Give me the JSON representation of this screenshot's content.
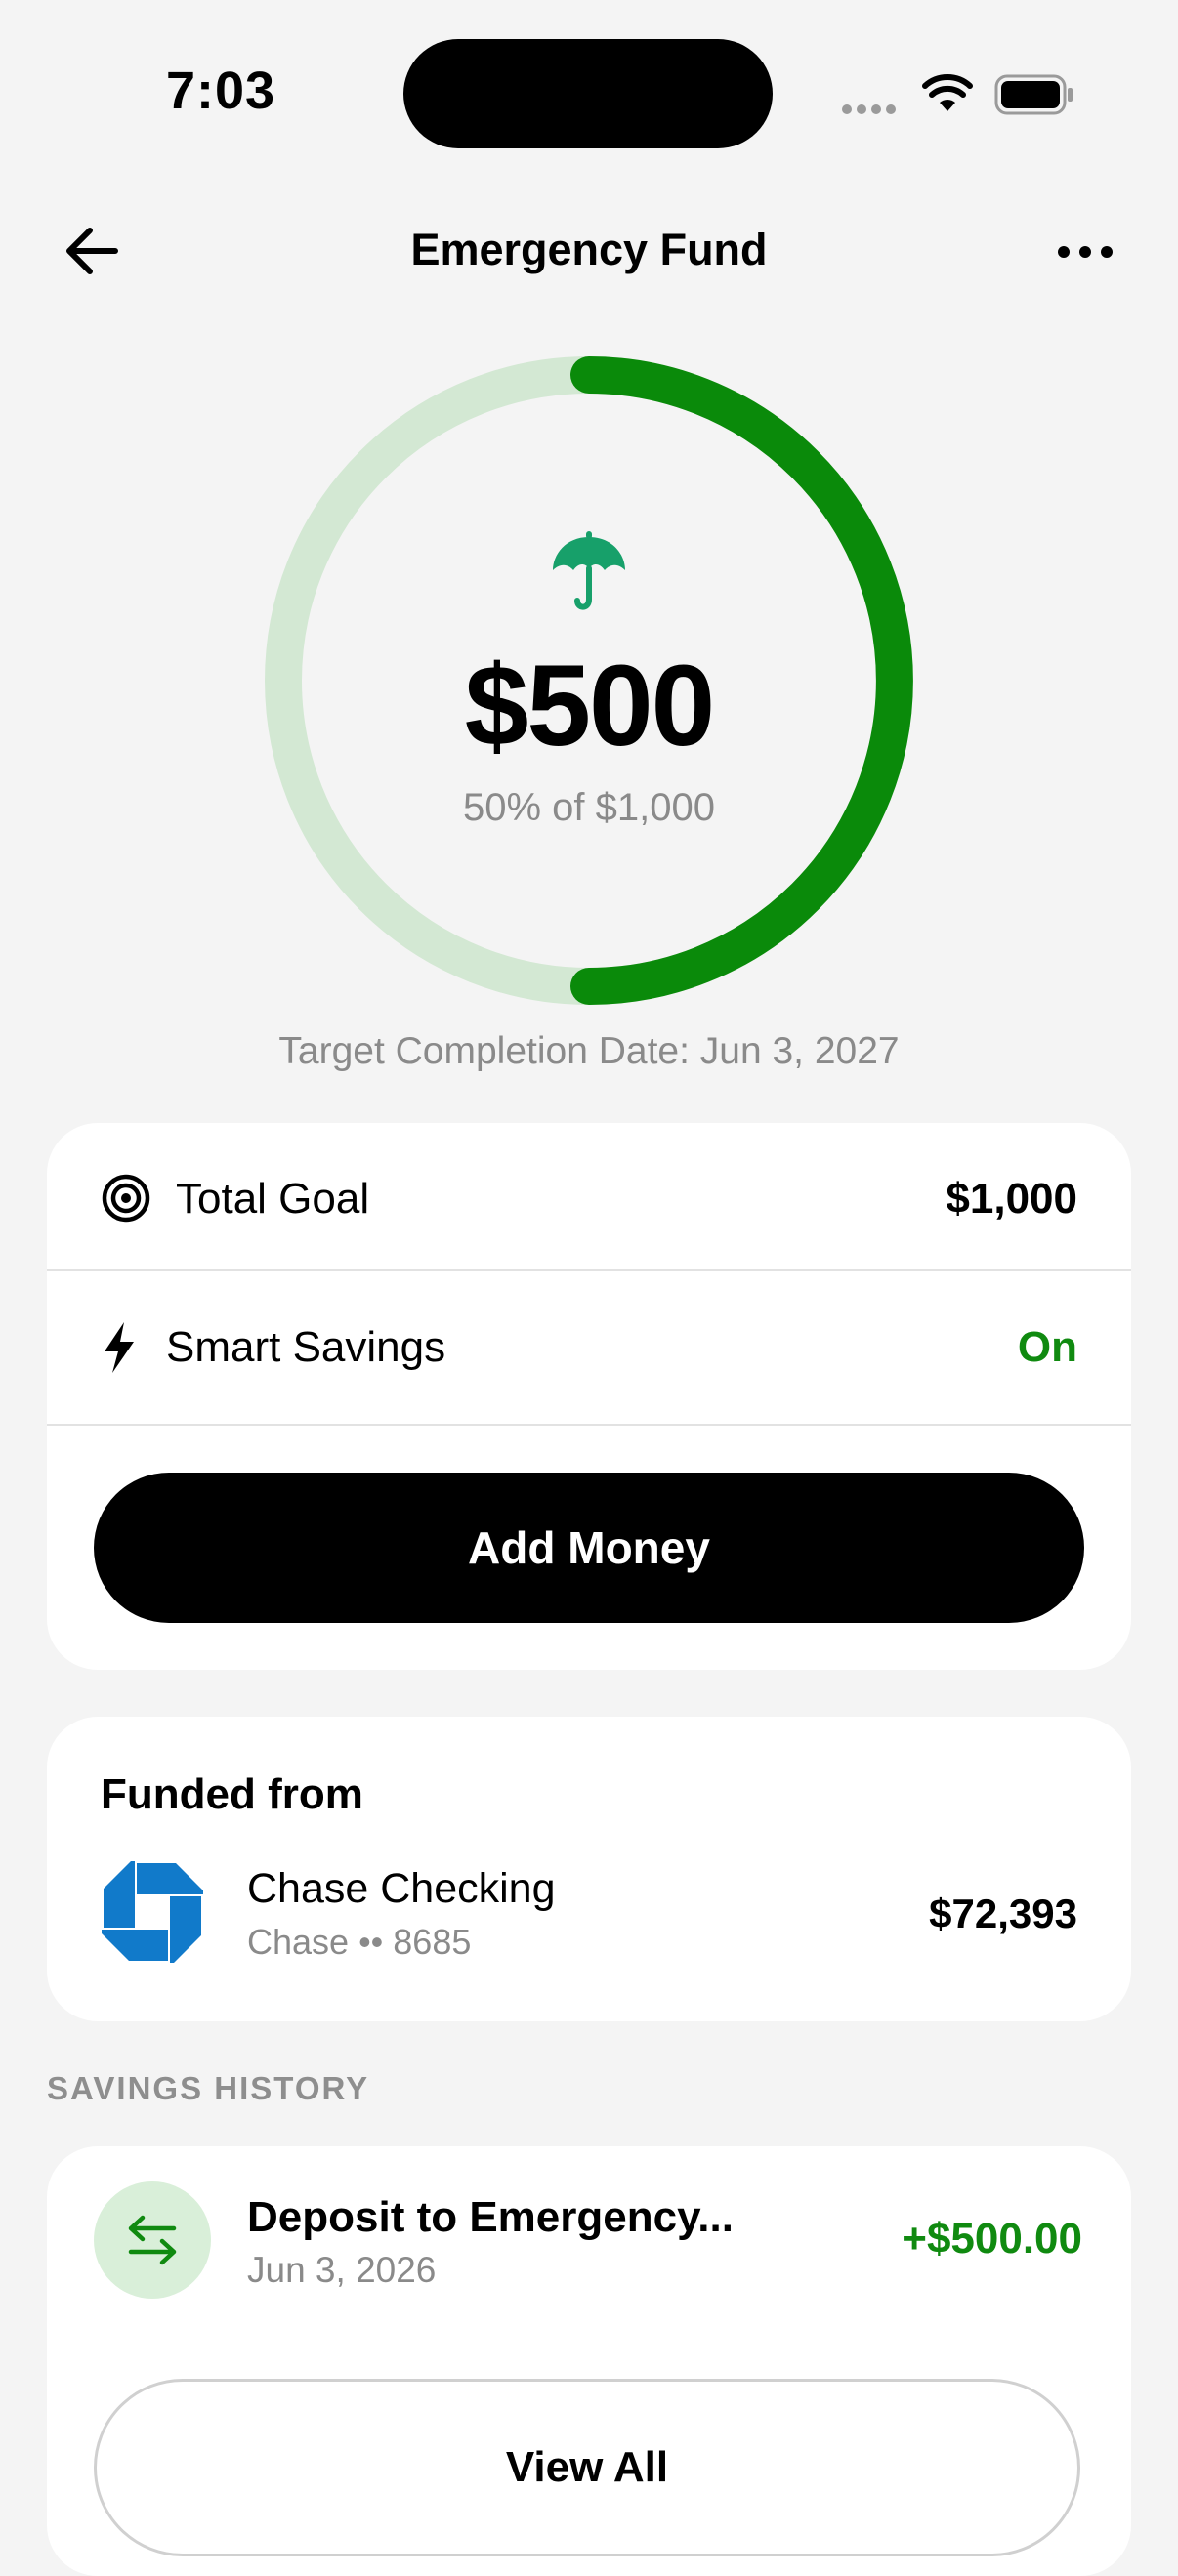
{
  "status_bar": {
    "time": "7:03",
    "icons": [
      "signal-icon",
      "wifi-icon",
      "battery-icon"
    ]
  },
  "header": {
    "title": "Emergency Fund",
    "back_icon": "arrow-left-icon",
    "more_icon": "more-horizontal-icon"
  },
  "progress": {
    "icon": "umbrella-icon",
    "amount": "$500",
    "subtitle": "50% of $1,000",
    "fraction": 0.5,
    "ring_color": "#0a8a0a",
    "ring_track_color": "#d3e8d3",
    "icon_color": "#17a06a"
  },
  "target_date": "Target Completion Date: Jun 3, 2027",
  "goal_card": {
    "total_goal": {
      "icon": "target-icon",
      "label": "Total Goal",
      "value": "$1,000"
    },
    "smart_savings": {
      "icon": "bolt-icon",
      "label": "Smart Savings",
      "value": "On",
      "value_color": "#108a10"
    },
    "add_money_label": "Add Money"
  },
  "funded_from": {
    "title": "Funded from",
    "account": {
      "icon": "chase-logo-icon",
      "name": "Chase Checking",
      "detail": "Chase •• 8685",
      "balance": "$72,393",
      "brand_color": "#117ACA"
    }
  },
  "savings_history": {
    "header": "SAVINGS HISTORY",
    "transactions": [
      {
        "icon": "transfer-arrows-icon",
        "title": "Deposit to Emergency...",
        "date": "Jun 3, 2026",
        "amount": "+$500.00"
      }
    ],
    "view_all_label": "View All"
  }
}
